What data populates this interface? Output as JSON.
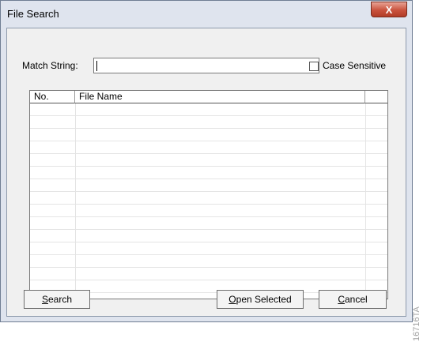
{
  "window": {
    "title": "File Search",
    "close_label": "X"
  },
  "match_string": {
    "label": "Match String:",
    "value": ""
  },
  "case_sensitive": {
    "label": "Case Sensitive",
    "checked": false
  },
  "file_list": {
    "columns": [
      "No.",
      "File Name"
    ],
    "rows": []
  },
  "buttons": {
    "search": {
      "hotkey": "S",
      "rest": "earch"
    },
    "open_selected": {
      "hotkey": "O",
      "rest": "pen Selected"
    },
    "cancel": {
      "hotkey": "C",
      "rest": "ancel"
    }
  },
  "figure_code": "16716TA"
}
